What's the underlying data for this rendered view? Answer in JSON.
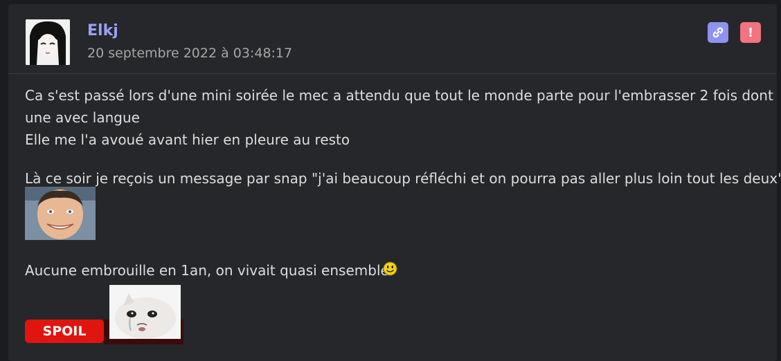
{
  "post": {
    "author": "Elkj",
    "date": "20 septembre 2022 à 03:48:17",
    "actions": {
      "link_icon": "link-icon",
      "report_icon": "exclamation-icon",
      "report_symbol": "!"
    },
    "lines": [
      "Ca s'est passé lors d'une mini soirée le mec a attendu que tout le monde parte pour l'embrasser 2 fois dont",
      "une avec langue",
      "Elle me l'a avoué avant hier en pleure au resto",
      "Là ce soir je reçois un message par snap \"j'ai beaucoup réfléchi et on pourra pas aller plus loin tout les deux\""
    ],
    "last_line": "Aucune embrouille en 1an, on vivait quasi ensemble",
    "spoil_label": "SPOIL"
  },
  "colors": {
    "background": "#1b1c1f",
    "card": "#26272a",
    "author": "#9aa0f5",
    "link_button": "#8d93ee",
    "report_button": "#f3737f",
    "spoil_button": "#e0150f"
  }
}
